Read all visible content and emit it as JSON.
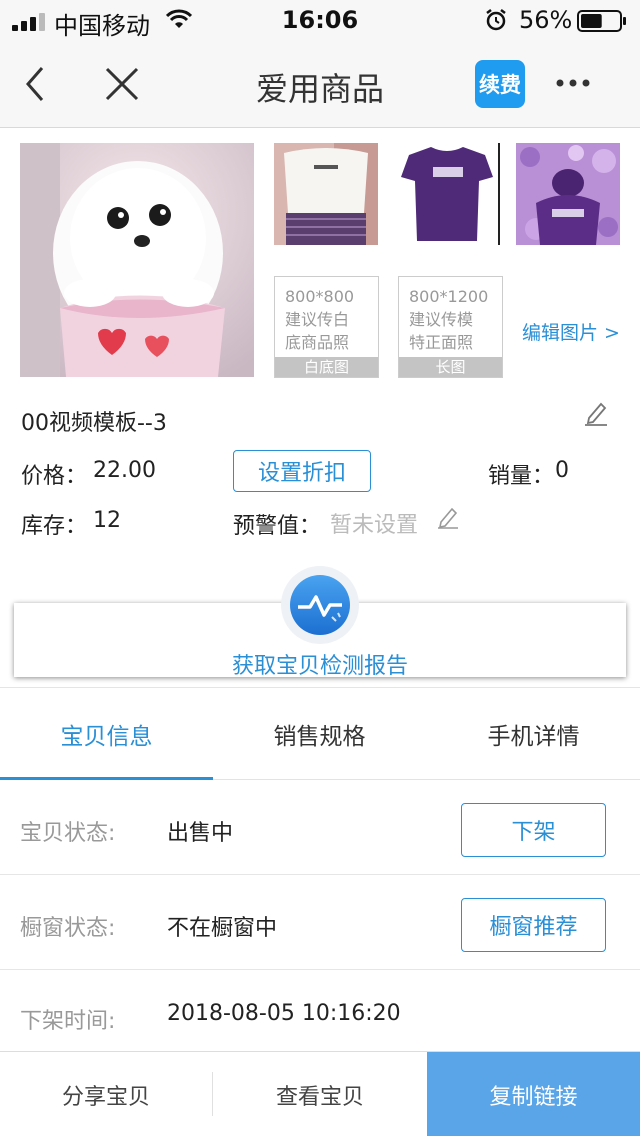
{
  "status_bar": {
    "carrier": "中国移动",
    "time": "16:06",
    "battery": "56%",
    "battery_level": 0.56
  },
  "nav": {
    "title": "爱用商品",
    "renew_label": "续费"
  },
  "images": {
    "hint_white": {
      "text": "800*800\n建议传白\n底商品照",
      "label": "白底图"
    },
    "hint_long": {
      "text": "800*1200\n建议传模\n特正面照",
      "label": "长图"
    },
    "edit_link": "编辑图片 >"
  },
  "product": {
    "name": "00视频模板--3",
    "price_label": "价格：",
    "price_value": "22.00",
    "discount_button": "设置折扣",
    "sales_label": "销量：",
    "sales_value": "0",
    "stock_label": "库存：",
    "stock_value": "12",
    "warn_label": "预警值：",
    "warn_value": "暂未设置"
  },
  "report": {
    "label": "获取宝贝检测报告"
  },
  "tabs": [
    {
      "label": "宝贝信息",
      "active": true
    },
    {
      "label": "销售规格",
      "active": false
    },
    {
      "label": "手机详情",
      "active": false
    }
  ],
  "details": [
    {
      "label": "宝贝状态:",
      "value": "出售中",
      "button": "下架"
    },
    {
      "label": "橱窗状态:",
      "value": "不在橱窗中",
      "button": "橱窗推荐"
    },
    {
      "label": "下架时间:",
      "value": "2018-08-05 10:16:20"
    }
  ],
  "bottom_bar": {
    "share": "分享宝贝",
    "view": "查看宝贝",
    "copy": "复制链接"
  },
  "colors": {
    "accent": "#2b8fd6",
    "renew_button": "#1f9bef",
    "copy_button": "#5aa5e8"
  }
}
